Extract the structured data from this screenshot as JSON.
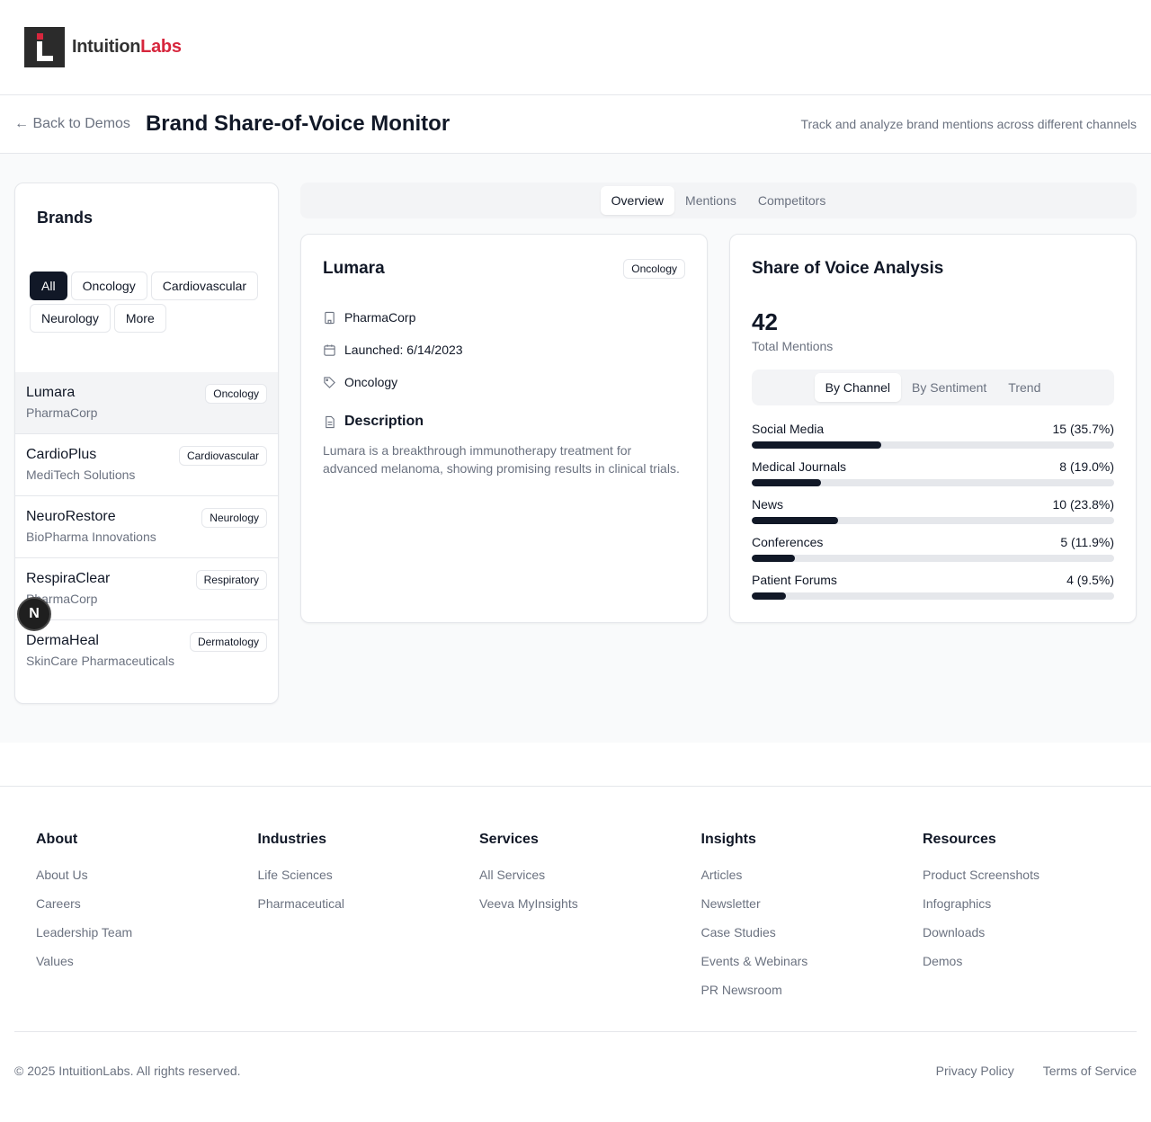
{
  "logo": {
    "part1": "Intuition",
    "part2": "Labs"
  },
  "titlebar": {
    "back": "← Back to Demos",
    "title": "Brand Share-of-Voice Monitor",
    "subtitle": "Track and analyze brand mentions across different channels"
  },
  "brands": {
    "title": "Brands",
    "filters": [
      "All",
      "Oncology",
      "Cardiovascular",
      "Neurology",
      "More"
    ],
    "active_filter": "All",
    "items": [
      {
        "name": "Lumara",
        "company": "PharmaCorp",
        "category": "Oncology"
      },
      {
        "name": "CardioPlus",
        "company": "MediTech Solutions",
        "category": "Cardiovascular"
      },
      {
        "name": "NeuroRestore",
        "company": "BioPharma Innovations",
        "category": "Neurology"
      },
      {
        "name": "RespiraClear",
        "company": "PharmaCorp",
        "category": "Respiratory"
      },
      {
        "name": "DermaHeal",
        "company": "SkinCare Pharmaceuticals",
        "category": "Dermatology"
      }
    ]
  },
  "tabs": [
    "Overview",
    "Mentions",
    "Competitors"
  ],
  "detail": {
    "name": "Lumara",
    "badge": "Oncology",
    "company": "PharmaCorp",
    "launched": "Launched: 6/14/2023",
    "category": "Oncology",
    "description_title": "Description",
    "description": "Lumara is a breakthrough immunotherapy treatment for advanced melanoma, showing promising results in clinical trials."
  },
  "sov": {
    "title": "Share of Voice Analysis",
    "total": "42",
    "total_label": "Total Mentions",
    "subtabs": [
      "By Channel",
      "By Sentiment",
      "Trend"
    ],
    "channels": [
      {
        "name": "Social Media",
        "value": "15 (35.7%)",
        "fraction": 0.357
      },
      {
        "name": "Medical Journals",
        "value": "8 (19.0%)",
        "fraction": 0.19
      },
      {
        "name": "News",
        "value": "10 (23.8%)",
        "fraction": 0.238
      },
      {
        "name": "Conferences",
        "value": "5 (11.9%)",
        "fraction": 0.119
      },
      {
        "name": "Patient Forums",
        "value": "4 (9.5%)",
        "fraction": 0.095
      }
    ]
  },
  "n_badge": "N",
  "footer": {
    "columns": [
      {
        "title": "About",
        "links": [
          "About Us",
          "Careers",
          "Leadership Team",
          "Values"
        ]
      },
      {
        "title": "Industries",
        "links": [
          "Life Sciences",
          "Pharmaceutical"
        ]
      },
      {
        "title": "Services",
        "links": [
          "All Services",
          "Veeva MyInsights"
        ]
      },
      {
        "title": "Insights",
        "links": [
          "Articles",
          "Newsletter",
          "Case Studies",
          "Events & Webinars",
          "PR Newsroom"
        ]
      },
      {
        "title": "Resources",
        "links": [
          "Product Screenshots",
          "Infographics",
          "Downloads",
          "Demos"
        ]
      }
    ],
    "copyright": "© 2025 IntuitionLabs. All rights reserved.",
    "legal": [
      "Privacy Policy",
      "Terms of Service"
    ]
  }
}
